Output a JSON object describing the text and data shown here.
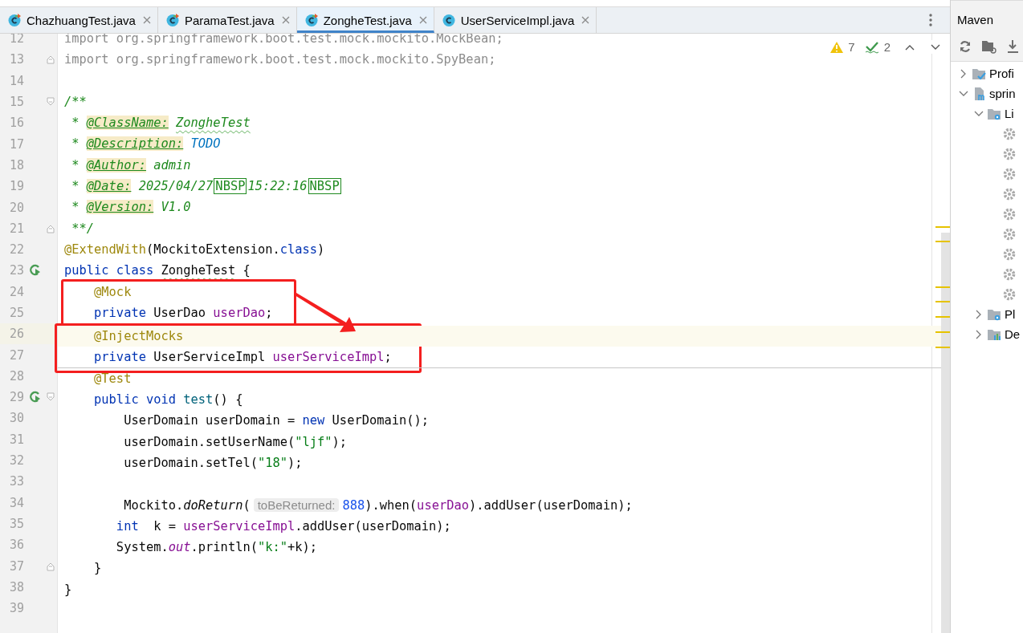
{
  "tabs": [
    {
      "label": "ChazhuangTest.java",
      "kind": "test-class",
      "selected": false
    },
    {
      "label": "ParamaTest.java",
      "kind": "test-class",
      "selected": false
    },
    {
      "label": "ZongheTest.java",
      "kind": "test-class",
      "selected": true
    },
    {
      "label": "UserServiceImpl.java",
      "kind": "class",
      "selected": false
    }
  ],
  "editor": {
    "inspections": {
      "warnings": "7",
      "checks": "2"
    },
    "annotation_arrow": true,
    "lines": [
      {
        "number": "12",
        "tokens": [
          {
            "text": "import org.springframework.boot.test.mock.mockito.MockBean;",
            "kind": "unused"
          }
        ]
      },
      {
        "number": "13",
        "fold_end": true,
        "tokens": [
          {
            "text": "import org.springframework.boot.test.mock.mockito.SpyBean;",
            "kind": "unused"
          }
        ]
      },
      {
        "number": "14"
      },
      {
        "number": "15",
        "fold_start": true,
        "tokens": [
          {
            "text": "/**",
            "kind": "comment"
          }
        ]
      },
      {
        "number": "16",
        "tokens": [
          {
            "text": " * ",
            "kind": "comment"
          },
          {
            "text": "@ClassName:",
            "kind": "doc-tag"
          },
          {
            "text": " ZongheTest",
            "kind": "comment",
            "typo": true
          }
        ]
      },
      {
        "number": "17",
        "tokens": [
          {
            "text": " * ",
            "kind": "comment"
          },
          {
            "text": "@Description:",
            "kind": "doc-tag"
          },
          {
            "text": " TODO",
            "kind": "todo"
          }
        ]
      },
      {
        "number": "18",
        "tokens": [
          {
            "text": " * ",
            "kind": "comment"
          },
          {
            "text": "@Author:",
            "kind": "doc-tag"
          },
          {
            "text": " admin",
            "kind": "comment"
          }
        ]
      },
      {
        "number": "19",
        "tokens": [
          {
            "text": " * ",
            "kind": "comment"
          },
          {
            "text": "@Date:",
            "kind": "doc-tag"
          },
          {
            "text": " 2025/04/27",
            "kind": "comment"
          },
          {
            "text": "NBSP",
            "kind": "nbsp"
          },
          {
            "text": "15:22:16",
            "kind": "comment"
          },
          {
            "text": "NBSP",
            "kind": "nbsp"
          }
        ]
      },
      {
        "number": "20",
        "tokens": [
          {
            "text": " * ",
            "kind": "comment"
          },
          {
            "text": "@Version:",
            "kind": "doc-tag"
          },
          {
            "text": " V1.0",
            "kind": "comment"
          }
        ]
      },
      {
        "number": "21",
        "fold_end": true,
        "tokens": [
          {
            "text": " **/",
            "kind": "comment"
          }
        ]
      },
      {
        "number": "22",
        "tokens": [
          {
            "text": "@ExtendWith",
            "kind": "annotation"
          },
          {
            "text": "(MockitoExtension.",
            "kind": "plain"
          },
          {
            "text": "class",
            "kind": "keyword"
          },
          {
            "text": ")",
            "kind": "plain"
          }
        ]
      },
      {
        "number": "23",
        "run_gutter_icon": true,
        "tokens": [
          {
            "text": "public class",
            "kind": "keyword"
          },
          {
            "text": " ZongheTest",
            "kind": "plain",
            "typo": true
          },
          {
            "text": " {",
            "kind": "plain"
          }
        ]
      },
      {
        "number": "24",
        "box_start": true,
        "boxed": true,
        "tokens": [
          {
            "text": "    @Mock",
            "kind": "annotation"
          }
        ]
      },
      {
        "number": "25",
        "boxed": true,
        "tokens": [
          {
            "text": "    private",
            "kind": "keyword"
          },
          {
            "text": " UserDao ",
            "kind": "plain"
          },
          {
            "text": "userDao",
            "kind": "field"
          },
          {
            "text": ";",
            "kind": "plain"
          }
        ]
      },
      {
        "number": "26",
        "box_start": true,
        "boxed": true,
        "current": true,
        "tokens": [
          {
            "text": "    @InjectMocks",
            "kind": "annotation"
          }
        ]
      },
      {
        "number": "27",
        "boxed": true,
        "separator": true,
        "tokens": [
          {
            "text": "    private",
            "kind": "keyword"
          },
          {
            "text": " UserServiceImpl ",
            "kind": "plain"
          },
          {
            "text": "userServiceImpl",
            "kind": "field"
          },
          {
            "text": ";",
            "kind": "plain"
          }
        ]
      },
      {
        "number": "28",
        "tokens": [
          {
            "text": "    @Test",
            "kind": "annotation"
          }
        ]
      },
      {
        "number": "29",
        "run_gutter_icon": true,
        "fold_start": true,
        "tokens": [
          {
            "text": "    public void",
            "kind": "keyword"
          },
          {
            "text": " test",
            "kind": "method"
          },
          {
            "text": "() {",
            "kind": "plain"
          }
        ]
      },
      {
        "number": "30",
        "tokens": [
          {
            "text": "        UserDomain userDomain = ",
            "kind": "plain"
          },
          {
            "text": "new",
            "kind": "keyword"
          },
          {
            "text": " UserDomain();",
            "kind": "plain"
          }
        ]
      },
      {
        "number": "31",
        "tokens": [
          {
            "text": "        userDomain.setUserName(",
            "kind": "plain"
          },
          {
            "text": "\"ljf\"",
            "kind": "string"
          },
          {
            "text": ");",
            "kind": "plain"
          }
        ]
      },
      {
        "number": "32",
        "tokens": [
          {
            "text": "        userDomain.setTel(",
            "kind": "plain"
          },
          {
            "text": "\"18\"",
            "kind": "string"
          },
          {
            "text": ");",
            "kind": "plain"
          }
        ]
      },
      {
        "number": "33"
      },
      {
        "number": "34",
        "tokens": [
          {
            "text": "        Mockito.",
            "kind": "plain"
          },
          {
            "text": "doReturn",
            "kind": "static-method"
          },
          {
            "text": "(",
            "kind": "plain"
          },
          {
            "text": "toBeReturned:",
            "kind": "hint"
          },
          {
            "text": "888",
            "kind": "number"
          },
          {
            "text": ").when(",
            "kind": "plain"
          },
          {
            "text": "userDao",
            "kind": "field"
          },
          {
            "text": ").addUser(userDomain);",
            "kind": "plain"
          }
        ]
      },
      {
        "number": "35",
        "tokens": [
          {
            "text": "       int",
            "kind": "keyword"
          },
          {
            "text": "  k = ",
            "kind": "plain"
          },
          {
            "text": "userServiceImpl",
            "kind": "field"
          },
          {
            "text": ".addUser(userDomain);",
            "kind": "plain"
          }
        ]
      },
      {
        "number": "36",
        "tokens": [
          {
            "text": "       System.",
            "kind": "plain"
          },
          {
            "text": "out",
            "kind": "static-field"
          },
          {
            "text": ".println(",
            "kind": "plain"
          },
          {
            "text": "\"k:\"",
            "kind": "string"
          },
          {
            "text": "+k);",
            "kind": "plain"
          }
        ]
      },
      {
        "number": "37",
        "fold_end": true,
        "tokens": [
          {
            "text": "    }",
            "kind": "plain"
          }
        ]
      },
      {
        "number": "38",
        "tokens": [
          {
            "text": "}",
            "kind": "plain"
          }
        ]
      },
      {
        "number": "39"
      }
    ]
  },
  "maven": {
    "title": "Maven",
    "tree": [
      {
        "label": "Profi",
        "kind": "profiles",
        "expanded": false
      },
      {
        "label": "sprin",
        "kind": "project",
        "expanded": true,
        "children": [
          {
            "label": "Li",
            "kind": "lifecycle",
            "expanded": true,
            "children": [
              {
                "kind": "goal"
              },
              {
                "kind": "goal"
              },
              {
                "kind": "goal"
              },
              {
                "kind": "goal"
              },
              {
                "kind": "goal"
              },
              {
                "kind": "goal"
              },
              {
                "kind": "goal"
              },
              {
                "kind": "goal"
              },
              {
                "kind": "goal"
              }
            ]
          },
          {
            "label": "Pl",
            "kind": "plugins",
            "expanded": false
          },
          {
            "label": "De",
            "kind": "dependencies",
            "expanded": false
          }
        ]
      }
    ]
  }
}
